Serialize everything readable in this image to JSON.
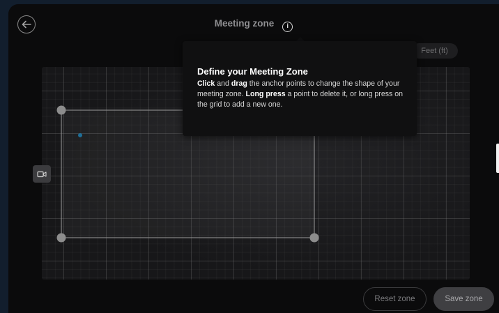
{
  "header": {
    "title": "Meeting zone"
  },
  "units_toggle": {
    "label": "Feet (ft)"
  },
  "tooltip": {
    "heading": "Define your Meeting Zone",
    "segments": {
      "s1": "Click",
      "s2": " and ",
      "s3": "drag",
      "s4": " the anchor points to change the shape of your meeting zone. ",
      "s5": "Long press",
      "s6": " a point to delete it, or long press on the grid to add a new one."
    }
  },
  "actions": {
    "reset_label": "Reset zone",
    "save_label": "Save zone"
  },
  "icons": {
    "back": "arrow-left-icon",
    "info": "info-icon",
    "camera": "camera-icon"
  },
  "colors": {
    "background": "#121e2d",
    "panel": "#0b0b0c",
    "tooltip": "#101011",
    "zone_outline": "#9a9a9a",
    "anchor_point": "#8d8d8d",
    "participant_dot": "#1f6f98"
  }
}
